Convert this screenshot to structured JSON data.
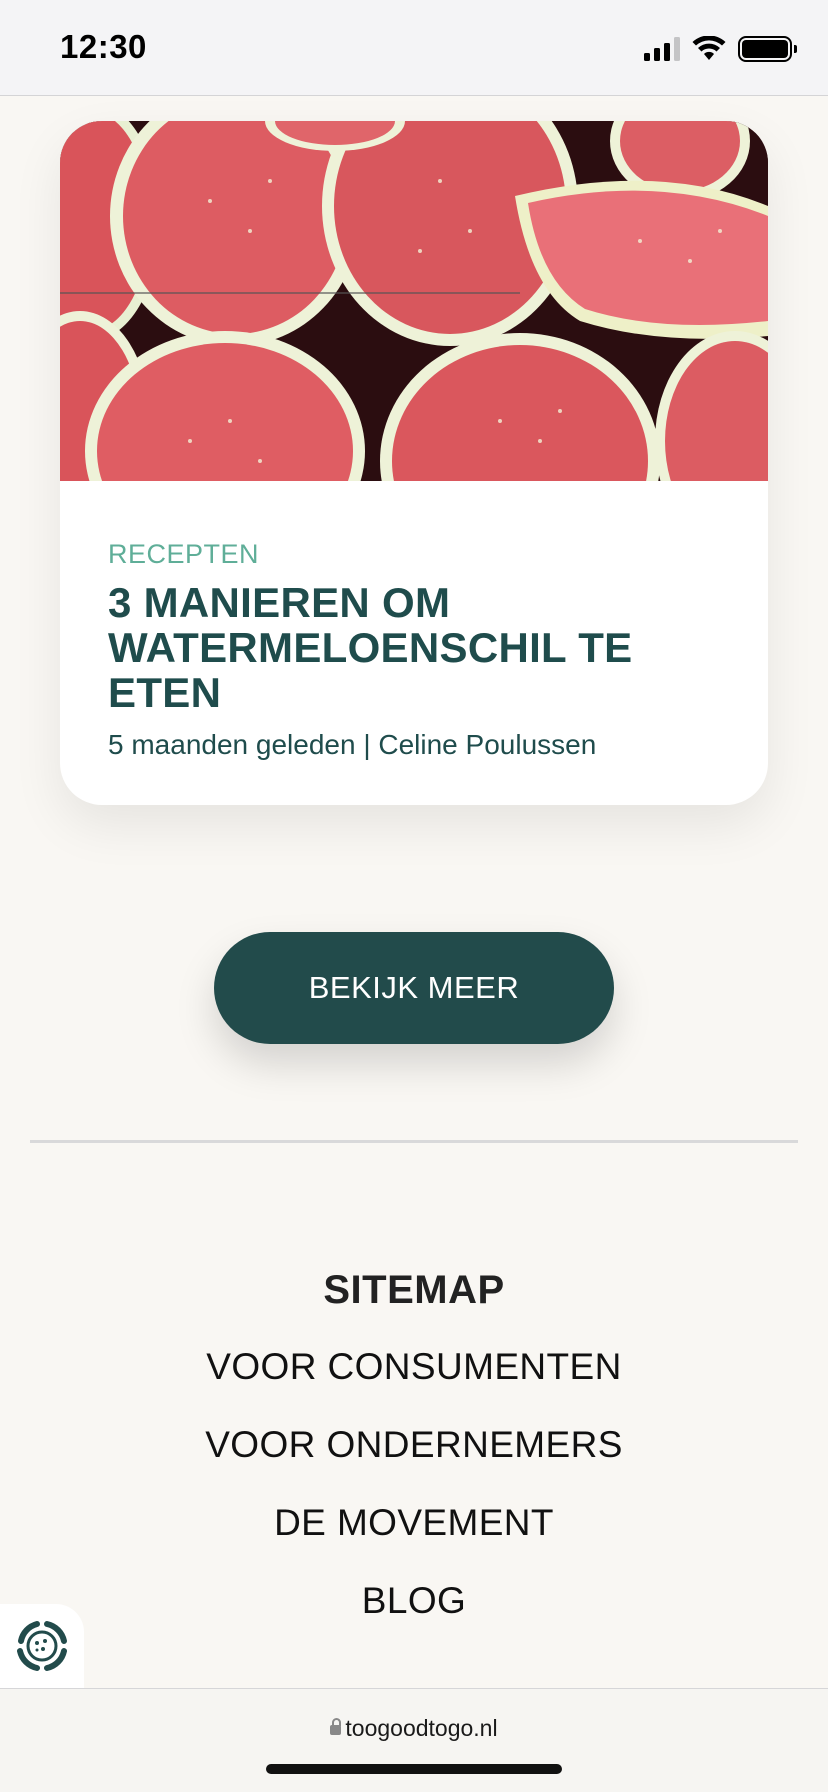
{
  "status_bar": {
    "time": "12:30"
  },
  "article": {
    "category": "RECEPTEN",
    "title": "3 MANIEREN OM WATERMELOENSCHIL TE ETEN",
    "meta": "5 maanden geleden | Celine Poulussen"
  },
  "more_button": {
    "label": "BEKIJK MEER"
  },
  "sitemap": {
    "title": "SITEMAP",
    "items": [
      {
        "label": "VOOR CONSUMENTEN"
      },
      {
        "label": "VOOR ONDERNEMERS"
      },
      {
        "label": "DE MOVEMENT"
      },
      {
        "label": "BLOG"
      }
    ]
  },
  "browser": {
    "url": "toogoodtogo.nl"
  },
  "colors": {
    "brand_dark": "#224b4b",
    "brand_green": "#5fae98",
    "background": "#f9f7f3"
  }
}
